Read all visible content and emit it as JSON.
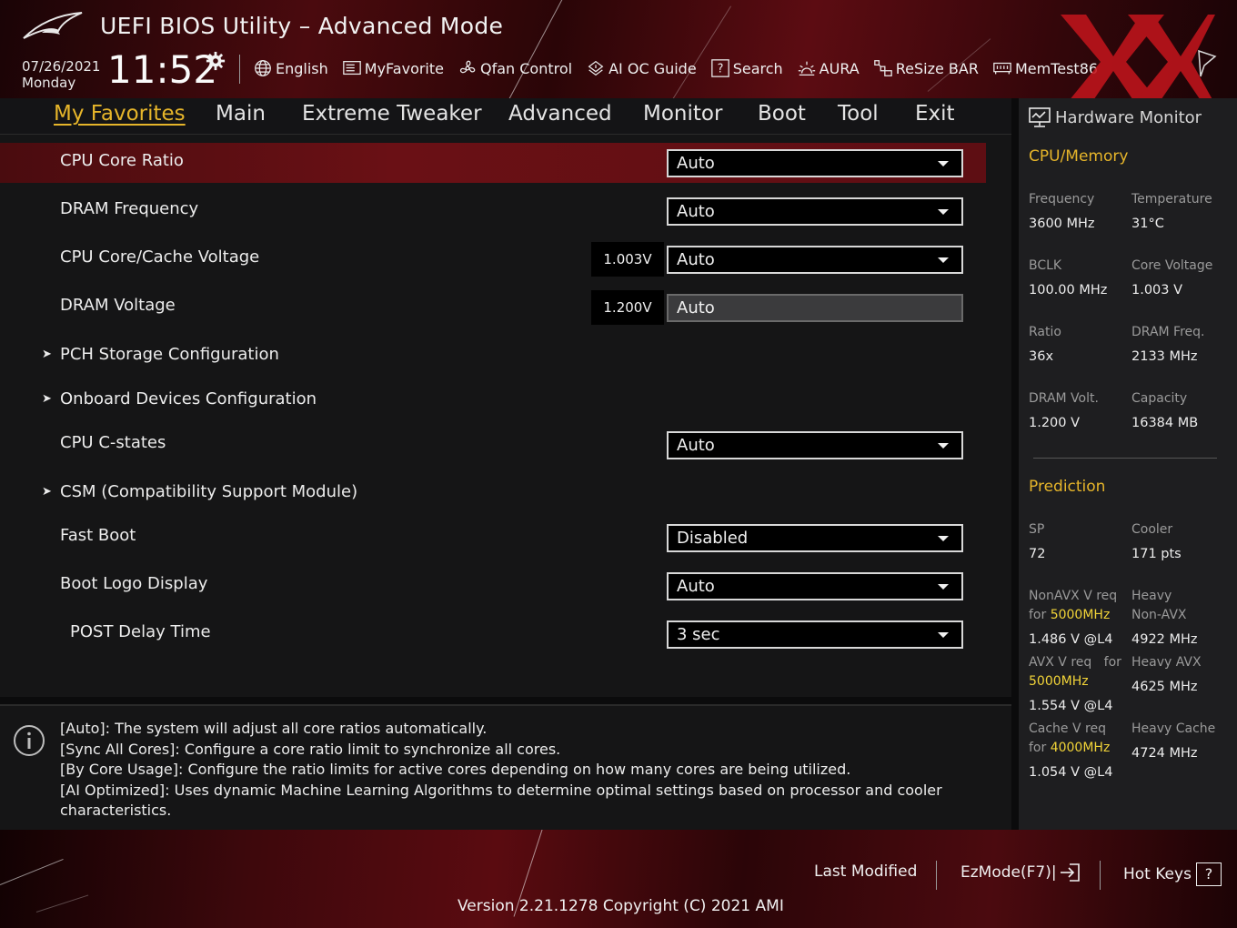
{
  "header": {
    "title": "UEFI BIOS Utility – Advanced Mode",
    "date": "07/26/2021",
    "day": "Monday",
    "time": "11:52",
    "toolbar": [
      {
        "label": "English",
        "icon": "globe-icon"
      },
      {
        "label": "MyFavorite",
        "icon": "favorite-icon"
      },
      {
        "label": "Qfan Control",
        "icon": "fan-icon"
      },
      {
        "label": "AI OC Guide",
        "icon": "ai-chip-icon"
      },
      {
        "label": "Search",
        "icon": "search-help-icon"
      },
      {
        "label": "AURA",
        "icon": "aura-light-icon"
      },
      {
        "label": "ReSize BAR",
        "icon": "resize-bar-icon"
      },
      {
        "label": "MemTest86",
        "icon": "memory-icon"
      }
    ]
  },
  "tabs": [
    "My Favorites",
    "Main",
    "Extreme Tweaker",
    "Advanced",
    "Monitor",
    "Boot",
    "Tool",
    "Exit"
  ],
  "active_tab": "My Favorites",
  "settings": [
    {
      "label": "CPU Core Ratio",
      "value": "Auto",
      "selected": true
    },
    {
      "label": "DRAM Frequency",
      "value": "Auto"
    },
    {
      "label": "CPU Core/Cache Voltage",
      "value": "Auto",
      "voltage": "1.003V"
    },
    {
      "label": "DRAM Voltage",
      "value": "Auto",
      "voltage": "1.200V",
      "disabled": true
    },
    {
      "label": "PCH Storage Configuration",
      "submenu": true
    },
    {
      "label": "Onboard Devices Configuration",
      "submenu": true
    },
    {
      "label": "CPU C-states",
      "value": "Auto"
    },
    {
      "label": "CSM (Compatibility Support Module)",
      "submenu": true
    },
    {
      "label": "Fast Boot",
      "value": "Disabled"
    },
    {
      "label": "Boot Logo Display",
      "value": "Auto"
    },
    {
      "label": "POST Delay Time",
      "value": "3 sec"
    }
  ],
  "help": {
    "lines": [
      "[Auto]: The system will adjust all core ratios automatically.",
      "[Sync All Cores]: Configure a core ratio limit to synchronize all cores.",
      "[By Core Usage]: Configure the ratio limits for active cores depending on how many cores are being utilized.",
      "[AI Optimized]: Uses dynamic Machine Learning Algorithms to determine optimal settings based on processor and cooler characteristics."
    ]
  },
  "hardware_monitor": {
    "title": "Hardware Monitor",
    "cpu_memory_title": "CPU/Memory",
    "frequency_label": "Frequency",
    "frequency": "3600 MHz",
    "temperature_label": "Temperature",
    "temperature": "31°C",
    "bclk_label": "BCLK",
    "bclk": "100.00 MHz",
    "core_voltage_label": "Core Voltage",
    "core_voltage": "1.003 V",
    "ratio_label": "Ratio",
    "ratio": "36x",
    "dram_freq_label": "DRAM Freq.",
    "dram_freq": "2133 MHz",
    "dram_volt_label": "DRAM Volt.",
    "dram_volt": "1.200 V",
    "capacity_label": "Capacity",
    "capacity": "16384 MB",
    "prediction_title": "Prediction",
    "sp_label": "SP",
    "sp": "72",
    "cooler_label": "Cooler",
    "cooler": "171 pts",
    "nonavx_label": "NonAVX V req",
    "for_label": "for",
    "nonavx_freq": "5000MHz",
    "nonavx_v": "1.486 V @L4",
    "heavy_label": "Heavy",
    "nonavx_word": "Non-AVX",
    "heavy_nonavx": "4922 MHz",
    "avx_label": "AVX V req",
    "avx_freq": "5000MHz",
    "avx_v": "1.554 V @L4",
    "heavy_avx_label": "Heavy AVX",
    "heavy_avx": "4625 MHz",
    "cache_label": "Cache V req",
    "cache_freq": "4000MHz",
    "cache_v": "1.054 V @L4",
    "heavy_cache_label": "Heavy Cache",
    "heavy_cache": "4724 MHz"
  },
  "footer": {
    "last_modified": "Last Modified",
    "ezmode": "EzMode(F7)|",
    "hotkeys": "Hot Keys",
    "hotkeys_glyph": "?",
    "version": "Version 2.21.1278 Copyright (C) 2021 AMI"
  },
  "colors": {
    "accent": "#e6b52a",
    "highlight": "#f2d438",
    "selected_row": "#6a1015",
    "brand_red": "#c0141c"
  }
}
